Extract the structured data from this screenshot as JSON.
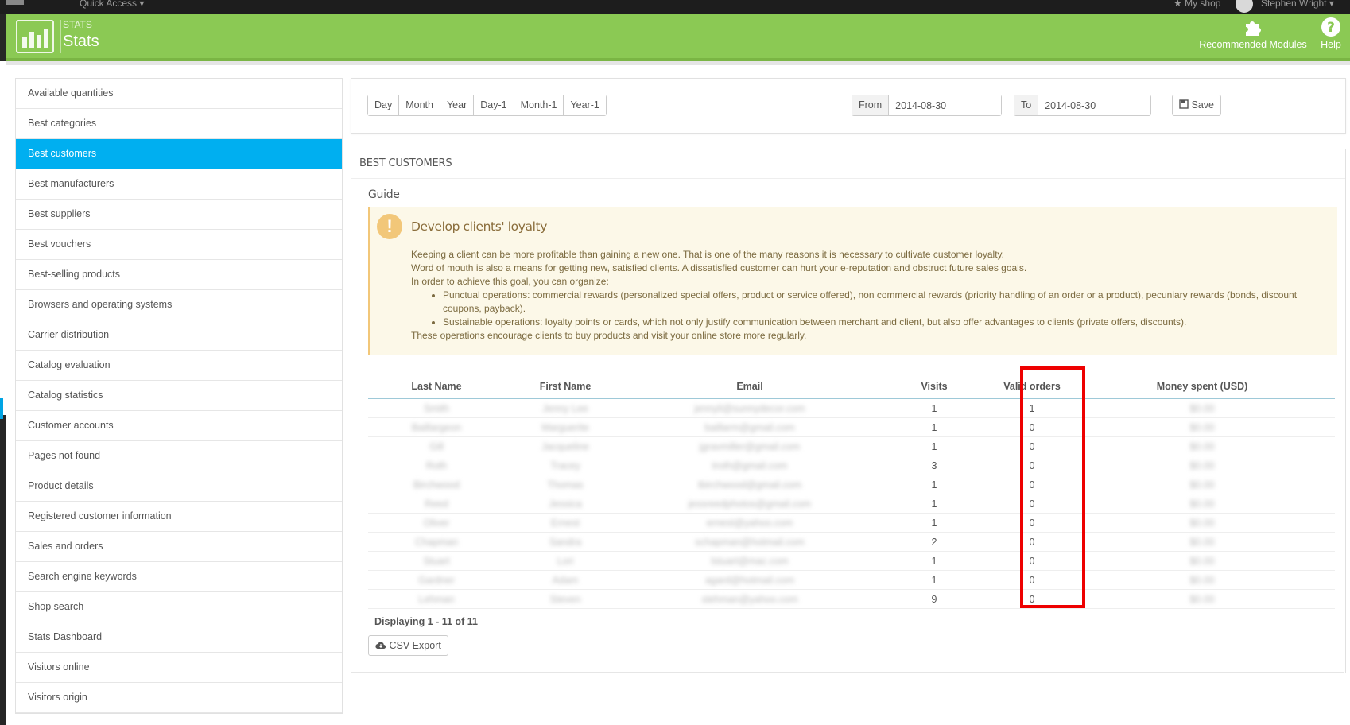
{
  "topbar": {
    "quick_access": "Quick Access ▾",
    "my_shop": "★ My shop",
    "user_name": "Stephen Wright ▾"
  },
  "header": {
    "breadcrumb": "STATS",
    "title": "Stats",
    "recommended_modules": "Recommended Modules",
    "help": "Help",
    "bg_color": "#8bc954"
  },
  "sidebar": {
    "active_index": 2,
    "items": [
      "Available quantities",
      "Best categories",
      "Best customers",
      "Best manufacturers",
      "Best suppliers",
      "Best vouchers",
      "Best-selling products",
      "Browsers and operating systems",
      "Carrier distribution",
      "Catalog evaluation",
      "Catalog statistics",
      "Customer accounts",
      "Pages not found",
      "Product details",
      "Registered customer information",
      "Sales and orders",
      "Search engine keywords",
      "Shop search",
      "Stats Dashboard",
      "Visitors online",
      "Visitors origin"
    ]
  },
  "date_filter": {
    "buttons": [
      "Day",
      "Month",
      "Year",
      "Day-1",
      "Month-1",
      "Year-1"
    ],
    "from_label": "From",
    "from_value": "2014-08-30",
    "to_label": "To",
    "to_value": "2014-08-30",
    "save_label": "Save"
  },
  "panel": {
    "title": "BEST CUSTOMERS",
    "guide_heading": "Guide",
    "alert": {
      "title": "Develop clients' loyalty",
      "line1": "Keeping a client can be more profitable than gaining a new one. That is one of the many reasons it is necessary to cultivate customer loyalty.",
      "line2": "Word of mouth is also a means for getting new, satisfied clients. A dissatisfied customer can hurt your e-reputation and obstruct future sales goals.",
      "line3": "In order to achieve this goal, you can organize:",
      "bullet1": "Punctual operations: commercial rewards (personalized special offers, product or service offered), non commercial rewards (priority handling of an order or a product), pecuniary rewards (bonds, discount coupons, payback).",
      "bullet2": "Sustainable operations: loyalty points or cards, which not only justify communication between merchant and client, but also offer advantages to clients (private offers, discounts).",
      "line4": "These operations encourage clients to buy products and visit your online store more regularly."
    },
    "table": {
      "headers": [
        "Last Name",
        "First Name",
        "Email",
        "Visits",
        "Valid orders",
        "Money spent (USD)"
      ],
      "rows": [
        {
          "last": "Smith",
          "first": "Jenny Lee",
          "email": "jennyli@sunnydecor.com",
          "visits": "1",
          "orders": "1",
          "money": "$0.00"
        },
        {
          "last": "Baillargeon",
          "first": "Marguerite",
          "email": "baillarm@gmail.com",
          "visits": "1",
          "orders": "0",
          "money": "$0.00"
        },
        {
          "last": "Gill",
          "first": "Jacqueline",
          "email": "jgravmiller@gmail.com",
          "visits": "1",
          "orders": "0",
          "money": "$0.00"
        },
        {
          "last": "Roth",
          "first": "Tracey",
          "email": "troth@gmail.com",
          "visits": "3",
          "orders": "0",
          "money": "$0.00"
        },
        {
          "last": "Birchwood",
          "first": "Thomas",
          "email": "tbirchwood@gmail.com",
          "visits": "1",
          "orders": "0",
          "money": "$0.00"
        },
        {
          "last": "Reed",
          "first": "Jessica",
          "email": "jessreedphotos@gmail.com",
          "visits": "1",
          "orders": "0",
          "money": "$0.00"
        },
        {
          "last": "Oliver",
          "first": "Ernest",
          "email": "ernest@yahoo.com",
          "visits": "1",
          "orders": "0",
          "money": "$0.00"
        },
        {
          "last": "Chapman",
          "first": "Sandra",
          "email": "schapman@hotmail.com",
          "visits": "2",
          "orders": "0",
          "money": "$0.00"
        },
        {
          "last": "Stuart",
          "first": "Lori",
          "email": "lstuart@mac.com",
          "visits": "1",
          "orders": "0",
          "money": "$0.00"
        },
        {
          "last": "Gardner",
          "first": "Adam",
          "email": "agard@hotmail.com",
          "visits": "1",
          "orders": "0",
          "money": "$0.00"
        },
        {
          "last": "Lehman",
          "first": "Steven",
          "email": "slehman@yahoo.com",
          "visits": "9",
          "orders": "0",
          "money": "$0.00"
        }
      ]
    },
    "paging": "Displaying 1 - 11 of 11",
    "csv_export": "CSV Export"
  },
  "colors": {
    "header_green": "#8bc954",
    "active_blue": "#00aff0",
    "highlight_red": "#ee0000",
    "alert_bg": "#fcf8e8"
  }
}
